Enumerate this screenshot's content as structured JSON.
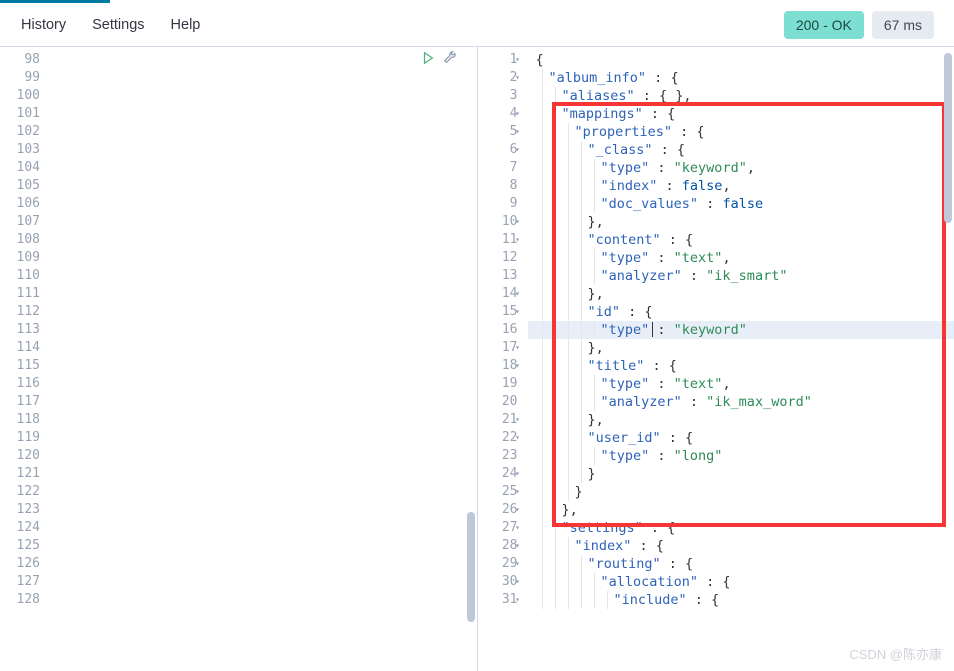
{
  "tabs": {
    "items": [
      {
        "label": "History"
      },
      {
        "label": "Settings"
      },
      {
        "label": "Help"
      }
    ]
  },
  "status": {
    "code_text": "200 - OK",
    "latency": "67 ms"
  },
  "left_editor": {
    "line_start": 98,
    "line_end": 128
  },
  "right_editor": {
    "highlight_line": 16,
    "lines": [
      {
        "n": 1,
        "fold": true,
        "indent": 0,
        "tokens": [
          {
            "t": "{",
            "c": "punct"
          }
        ]
      },
      {
        "n": 2,
        "fold": true,
        "indent": 1,
        "tokens": [
          {
            "t": "\"album_info\"",
            "c": "key"
          },
          {
            "t": " : ",
            "c": "punct"
          },
          {
            "t": "{",
            "c": "punct"
          }
        ]
      },
      {
        "n": 3,
        "fold": false,
        "indent": 2,
        "tokens": [
          {
            "t": "\"aliases\"",
            "c": "key"
          },
          {
            "t": " : { },",
            "c": "punct"
          }
        ]
      },
      {
        "n": 4,
        "fold": true,
        "indent": 2,
        "tokens": [
          {
            "t": "\"mappings\"",
            "c": "key"
          },
          {
            "t": " : {",
            "c": "punct"
          }
        ]
      },
      {
        "n": 5,
        "fold": true,
        "indent": 3,
        "tokens": [
          {
            "t": "\"properties\"",
            "c": "key"
          },
          {
            "t": " : {",
            "c": "punct"
          }
        ]
      },
      {
        "n": 6,
        "fold": true,
        "indent": 4,
        "tokens": [
          {
            "t": "\"_class\"",
            "c": "key"
          },
          {
            "t": " : {",
            "c": "punct"
          }
        ]
      },
      {
        "n": 7,
        "fold": false,
        "indent": 5,
        "tokens": [
          {
            "t": "\"type\"",
            "c": "key"
          },
          {
            "t": " : ",
            "c": "punct"
          },
          {
            "t": "\"keyword\"",
            "c": "str"
          },
          {
            "t": ",",
            "c": "punct"
          }
        ]
      },
      {
        "n": 8,
        "fold": false,
        "indent": 5,
        "tokens": [
          {
            "t": "\"index\"",
            "c": "key"
          },
          {
            "t": " : ",
            "c": "punct"
          },
          {
            "t": "false",
            "c": "bool"
          },
          {
            "t": ",",
            "c": "punct"
          }
        ]
      },
      {
        "n": 9,
        "fold": false,
        "indent": 5,
        "tokens": [
          {
            "t": "\"doc_values\"",
            "c": "key"
          },
          {
            "t": " : ",
            "c": "punct"
          },
          {
            "t": "false",
            "c": "bool"
          }
        ]
      },
      {
        "n": 10,
        "fold": true,
        "indent": 4,
        "tokens": [
          {
            "t": "},",
            "c": "punct"
          }
        ]
      },
      {
        "n": 11,
        "fold": true,
        "indent": 4,
        "tokens": [
          {
            "t": "\"content\"",
            "c": "key"
          },
          {
            "t": " : {",
            "c": "punct"
          }
        ]
      },
      {
        "n": 12,
        "fold": false,
        "indent": 5,
        "tokens": [
          {
            "t": "\"type\"",
            "c": "key"
          },
          {
            "t": " : ",
            "c": "punct"
          },
          {
            "t": "\"text\"",
            "c": "str"
          },
          {
            "t": ",",
            "c": "punct"
          }
        ]
      },
      {
        "n": 13,
        "fold": false,
        "indent": 5,
        "tokens": [
          {
            "t": "\"analyzer\"",
            "c": "key"
          },
          {
            "t": " : ",
            "c": "punct"
          },
          {
            "t": "\"ik_smart\"",
            "c": "str"
          }
        ]
      },
      {
        "n": 14,
        "fold": true,
        "indent": 4,
        "tokens": [
          {
            "t": "},",
            "c": "punct"
          }
        ]
      },
      {
        "n": 15,
        "fold": true,
        "indent": 4,
        "tokens": [
          {
            "t": "\"id\"",
            "c": "key"
          },
          {
            "t": " : {",
            "c": "punct"
          }
        ]
      },
      {
        "n": 16,
        "fold": false,
        "indent": 5,
        "tokens": [
          {
            "t": "\"type\"",
            "c": "key"
          },
          {
            "t": " : ",
            "c": "punct"
          },
          {
            "t": "\"keyword\"",
            "c": "str"
          }
        ]
      },
      {
        "n": 17,
        "fold": true,
        "indent": 4,
        "tokens": [
          {
            "t": "},",
            "c": "punct"
          }
        ]
      },
      {
        "n": 18,
        "fold": true,
        "indent": 4,
        "tokens": [
          {
            "t": "\"title\"",
            "c": "key"
          },
          {
            "t": " : {",
            "c": "punct"
          }
        ]
      },
      {
        "n": 19,
        "fold": false,
        "indent": 5,
        "tokens": [
          {
            "t": "\"type\"",
            "c": "key"
          },
          {
            "t": " : ",
            "c": "punct"
          },
          {
            "t": "\"text\"",
            "c": "str"
          },
          {
            "t": ",",
            "c": "punct"
          }
        ]
      },
      {
        "n": 20,
        "fold": false,
        "indent": 5,
        "tokens": [
          {
            "t": "\"analyzer\"",
            "c": "key"
          },
          {
            "t": " : ",
            "c": "punct"
          },
          {
            "t": "\"ik_max_word\"",
            "c": "str"
          }
        ]
      },
      {
        "n": 21,
        "fold": true,
        "indent": 4,
        "tokens": [
          {
            "t": "},",
            "c": "punct"
          }
        ]
      },
      {
        "n": 22,
        "fold": true,
        "indent": 4,
        "tokens": [
          {
            "t": "\"user_id\"",
            "c": "key"
          },
          {
            "t": " : {",
            "c": "punct"
          }
        ]
      },
      {
        "n": 23,
        "fold": false,
        "indent": 5,
        "tokens": [
          {
            "t": "\"type\"",
            "c": "key"
          },
          {
            "t": " : ",
            "c": "punct"
          },
          {
            "t": "\"long\"",
            "c": "str"
          }
        ]
      },
      {
        "n": 24,
        "fold": true,
        "indent": 4,
        "tokens": [
          {
            "t": "}",
            "c": "punct"
          }
        ]
      },
      {
        "n": 25,
        "fold": true,
        "indent": 3,
        "tokens": [
          {
            "t": "}",
            "c": "punct"
          }
        ]
      },
      {
        "n": 26,
        "fold": true,
        "indent": 2,
        "tokens": [
          {
            "t": "},",
            "c": "punct"
          }
        ]
      },
      {
        "n": 27,
        "fold": true,
        "indent": 2,
        "tokens": [
          {
            "t": "\"settings\"",
            "c": "key"
          },
          {
            "t": " : {",
            "c": "punct"
          }
        ]
      },
      {
        "n": 28,
        "fold": true,
        "indent": 3,
        "tokens": [
          {
            "t": "\"index\"",
            "c": "key"
          },
          {
            "t": " : {",
            "c": "punct"
          }
        ]
      },
      {
        "n": 29,
        "fold": true,
        "indent": 4,
        "tokens": [
          {
            "t": "\"routing\"",
            "c": "key"
          },
          {
            "t": " : {",
            "c": "punct"
          }
        ]
      },
      {
        "n": 30,
        "fold": true,
        "indent": 5,
        "tokens": [
          {
            "t": "\"allocation\"",
            "c": "key"
          },
          {
            "t": " : {",
            "c": "punct"
          }
        ]
      },
      {
        "n": 31,
        "fold": true,
        "indent": 6,
        "tokens": [
          {
            "t": "\"include\"",
            "c": "key"
          },
          {
            "t": " : {",
            "c": "punct"
          }
        ]
      }
    ]
  },
  "watermark": "CSDN @陈亦康"
}
